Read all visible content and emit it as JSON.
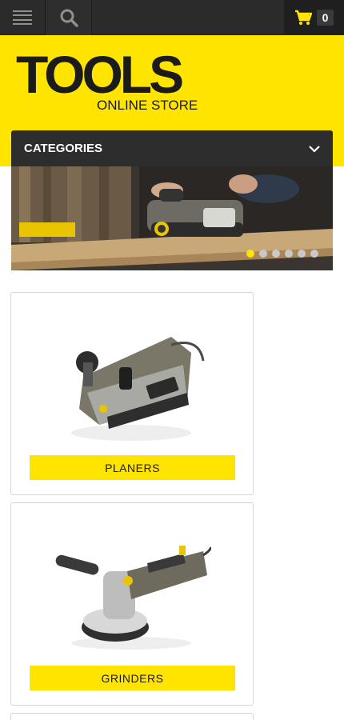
{
  "topbar": {
    "menu_icon": "hamburger-icon",
    "search_icon": "search-icon",
    "cart_icon": "cart-icon",
    "cart_count": "0",
    "accent": "#ffe400"
  },
  "header": {
    "logo_title": "TOOLS",
    "logo_subtitle": "ONLINE STORE"
  },
  "categories": {
    "label": "CATEGORIES",
    "icon": "chevron-down-icon"
  },
  "slider": {
    "dots_total": 6,
    "active_dot": 1
  },
  "products": [
    {
      "label": "PLANERS"
    },
    {
      "label": "GRINDERS"
    }
  ]
}
